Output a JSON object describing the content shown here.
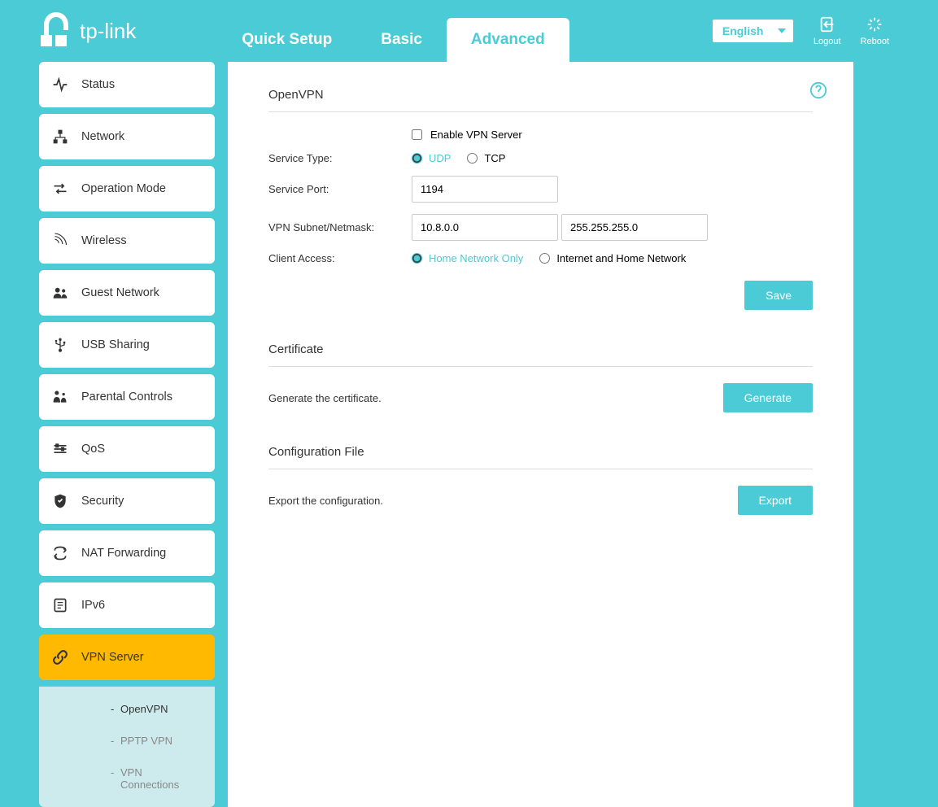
{
  "brand": "tp-link",
  "tabs": {
    "quick": "Quick Setup",
    "basic": "Basic",
    "advanced": "Advanced"
  },
  "header": {
    "language": "English",
    "logout": "Logout",
    "reboot": "Reboot"
  },
  "sidebar": {
    "status": "Status",
    "network": "Network",
    "operation": "Operation Mode",
    "wireless": "Wireless",
    "guest": "Guest Network",
    "usb": "USB Sharing",
    "parental": "Parental Controls",
    "qos": "QoS",
    "security": "Security",
    "nat": "NAT Forwarding",
    "ipv6": "IPv6",
    "vpn": "VPN Server",
    "sub": {
      "openvpn": "OpenVPN",
      "pptp": "PPTP VPN",
      "conn": "VPN Connections"
    }
  },
  "openvpn": {
    "title": "OpenVPN",
    "enable_label": "Enable VPN Server",
    "service_type_label": "Service Type:",
    "udp": "UDP",
    "tcp": "TCP",
    "service_port_label": "Service Port:",
    "service_port_value": "1194",
    "subnet_label": "VPN Subnet/Netmask:",
    "subnet_value": "10.8.0.0",
    "netmask_value": "255.255.255.0",
    "client_access_label": "Client Access:",
    "home_only": "Home Network Only",
    "internet_home": "Internet and Home Network",
    "save": "Save"
  },
  "cert": {
    "title": "Certificate",
    "desc": "Generate the certificate.",
    "btn": "Generate"
  },
  "config": {
    "title": "Configuration File",
    "desc": "Export the configuration.",
    "btn": "Export"
  }
}
